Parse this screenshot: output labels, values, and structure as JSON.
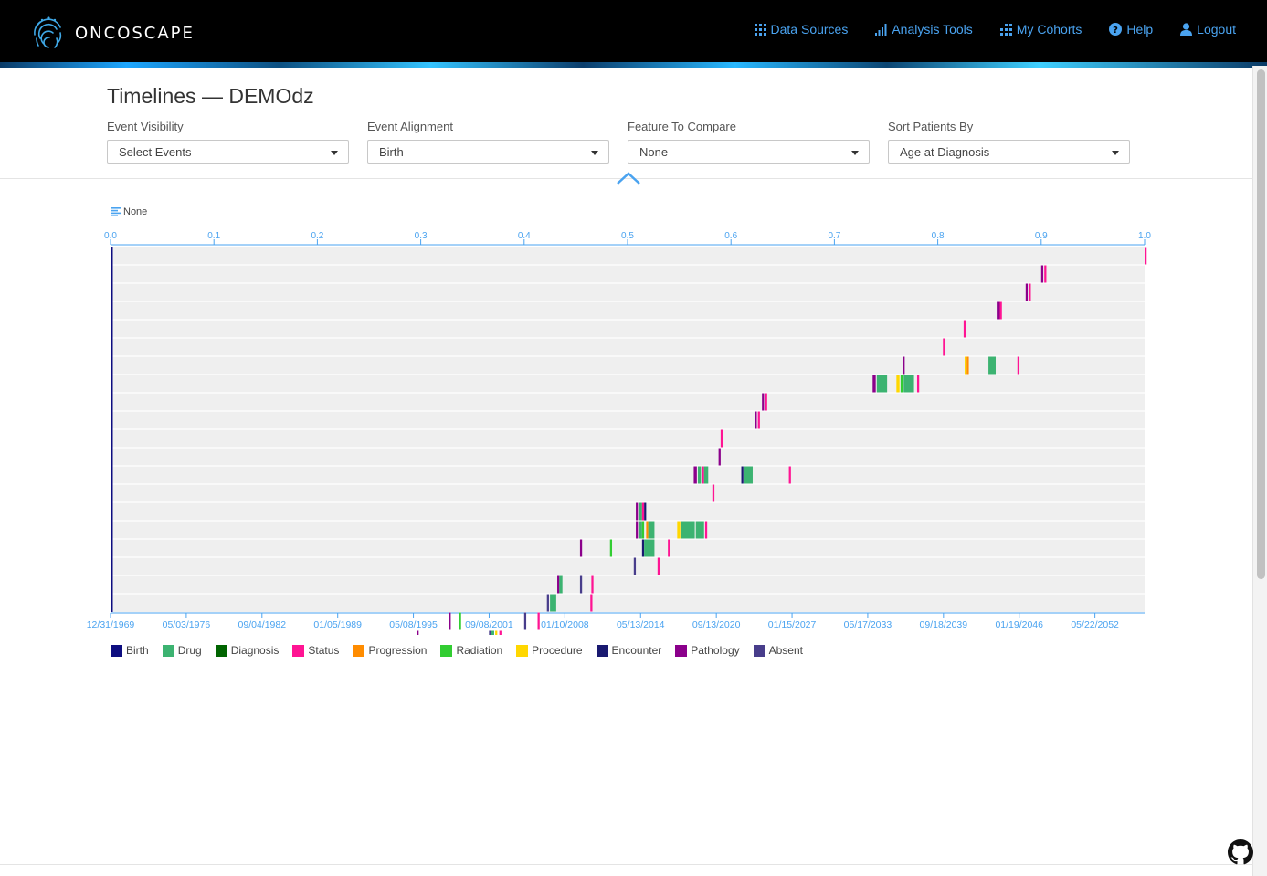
{
  "navbar": {
    "brand": "ONCOSCAPE",
    "links": [
      {
        "label": "Data Sources",
        "icon": "grid-icon"
      },
      {
        "label": "Analysis Tools",
        "icon": "bar-chart-icon"
      },
      {
        "label": "My Cohorts",
        "icon": "cohorts-icon"
      },
      {
        "label": "Help",
        "icon": "help-icon"
      },
      {
        "label": "Logout",
        "icon": "user-icon"
      }
    ]
  },
  "page": {
    "title": "Timelines — DEMOdz"
  },
  "controls": [
    {
      "label": "Event Visibility",
      "value": "Select Events"
    },
    {
      "label": "Event Alignment",
      "value": "Birth"
    },
    {
      "label": "Feature To Compare",
      "value": "None"
    },
    {
      "label": "Sort Patients By",
      "value": "Age at Diagnosis"
    }
  ],
  "colors": {
    "Birth": "#0d0d80",
    "Drug": "#3cb371",
    "Diagnosis": "#006400",
    "Status": "#ff1493",
    "Progression": "#ff8c00",
    "Radiation": "#32cd32",
    "Procedure": "#ffd700",
    "Encounter": "#191970",
    "Pathology": "#8b008b",
    "Absent": "#483d8b"
  },
  "chart_data": {
    "type": "timeline",
    "feature_label": "None",
    "top_axis": {
      "ticks": [
        "0.0",
        "0.1",
        "0.2",
        "0.3",
        "0.4",
        "0.5",
        "0.6",
        "0.7",
        "0.8",
        "0.9",
        "1.0"
      ],
      "range": [
        0,
        1
      ]
    },
    "bottom_axis": {
      "ticks": [
        "12/31/1969",
        "05/03/1976",
        "09/04/1982",
        "01/05/1989",
        "05/08/1995",
        "09/08/2001",
        "01/10/2008",
        "05/13/2014",
        "09/13/2020",
        "01/15/2027",
        "05/17/2033",
        "09/18/2039",
        "01/19/2046",
        "05/22/2052"
      ],
      "range": [
        "12/31/1969",
        "07/2058"
      ]
    },
    "legend": [
      "Birth",
      "Drug",
      "Diagnosis",
      "Status",
      "Progression",
      "Radiation",
      "Procedure",
      "Encounter",
      "Pathology",
      "Absent"
    ],
    "rows": [
      [
        [
          "Status",
          1.0,
          1.002
        ]
      ],
      [
        [
          "Pathology",
          0.9,
          0.902
        ],
        [
          "Status",
          0.903,
          0.905
        ]
      ],
      [
        [
          "Pathology",
          0.885,
          0.887
        ],
        [
          "Status",
          0.888,
          0.89
        ]
      ],
      [
        [
          "Pathology",
          0.857,
          0.86
        ],
        [
          "Status",
          0.86,
          0.862
        ]
      ],
      [
        [
          "Status",
          0.825,
          0.827
        ]
      ],
      [
        [
          "Status",
          0.805,
          0.807
        ]
      ],
      [
        [
          "Pathology",
          0.766,
          0.768
        ],
        [
          "Procedure",
          0.826,
          0.828
        ],
        [
          "Progression",
          0.828,
          0.83
        ],
        [
          "Drug",
          0.849,
          0.856
        ],
        [
          "Status",
          0.877,
          0.879
        ]
      ],
      [
        [
          "Pathology",
          0.737,
          0.74
        ],
        [
          "Drug",
          0.741,
          0.751
        ],
        [
          "Procedure",
          0.76,
          0.763
        ],
        [
          "Radiation",
          0.764,
          0.766
        ],
        [
          "Drug",
          0.767,
          0.777
        ],
        [
          "Status",
          0.78,
          0.782
        ]
      ],
      [
        [
          "Pathology",
          0.63,
          0.632
        ],
        [
          "Status",
          0.633,
          0.635
        ]
      ],
      [
        [
          "Pathology",
          0.623,
          0.625
        ],
        [
          "Status",
          0.626,
          0.628
        ]
      ],
      [
        [
          "Status",
          0.59,
          0.592
        ]
      ],
      [
        [
          "Pathology",
          0.588,
          0.59
        ]
      ],
      [
        [
          "Pathology",
          0.564,
          0.567
        ],
        [
          "Drug",
          0.568,
          0.571
        ],
        [
          "Status",
          0.572,
          0.574
        ],
        [
          "Drug",
          0.574,
          0.578
        ],
        [
          "Encounter",
          0.61,
          0.612
        ],
        [
          "Drug",
          0.613,
          0.621
        ],
        [
          "Status",
          0.656,
          0.658
        ]
      ],
      [
        [
          "Status",
          0.582,
          0.584
        ]
      ],
      [
        [
          "Pathology",
          0.508,
          0.51
        ],
        [
          "Drug",
          0.511,
          0.514
        ],
        [
          "Encounter",
          0.516,
          0.518
        ],
        [
          "Status",
          0.514,
          0.516
        ]
      ],
      [
        [
          "Pathology",
          0.508,
          0.51
        ],
        [
          "Drug",
          0.511,
          0.514
        ],
        [
          "Radiation",
          0.514,
          0.516
        ],
        [
          "Progression",
          0.518,
          0.52
        ],
        [
          "Drug",
          0.52,
          0.526
        ],
        [
          "Procedure",
          0.548,
          0.551
        ],
        [
          "Drug",
          0.552,
          0.565
        ],
        [
          "Drug",
          0.566,
          0.574
        ],
        [
          "Status",
          0.575,
          0.577
        ]
      ],
      [
        [
          "Pathology",
          0.454,
          0.456
        ],
        [
          "Radiation",
          0.483,
          0.485
        ],
        [
          "Encounter",
          0.514,
          0.516
        ],
        [
          "Drug",
          0.516,
          0.526
        ],
        [
          "Status",
          0.539,
          0.541
        ]
      ],
      [
        [
          "Absent",
          0.506,
          0.508
        ],
        [
          "Status",
          0.529,
          0.531
        ]
      ],
      [
        [
          "Pathology",
          0.432,
          0.434
        ],
        [
          "Drug",
          0.434,
          0.437
        ],
        [
          "Absent",
          0.454,
          0.456
        ],
        [
          "Status",
          0.465,
          0.467
        ]
      ],
      [
        [
          "Absent",
          0.422,
          0.424
        ],
        [
          "Drug",
          0.425,
          0.431
        ],
        [
          "Status",
          0.464,
          0.466
        ]
      ],
      [
        [
          "Pathology",
          0.327,
          0.329
        ],
        [
          "Radiation",
          0.337,
          0.339
        ],
        [
          "Absent",
          0.4,
          0.402
        ],
        [
          "Status",
          0.413,
          0.415
        ]
      ],
      [
        [
          "Pathology",
          0.296,
          0.298
        ],
        [
          "Absent",
          0.366,
          0.368
        ],
        [
          "Drug",
          0.368,
          0.371
        ],
        [
          "Procedure",
          0.372,
          0.374
        ],
        [
          "Status",
          0.376,
          0.378
        ]
      ]
    ]
  },
  "footer": {
    "icon": "github-icon"
  }
}
